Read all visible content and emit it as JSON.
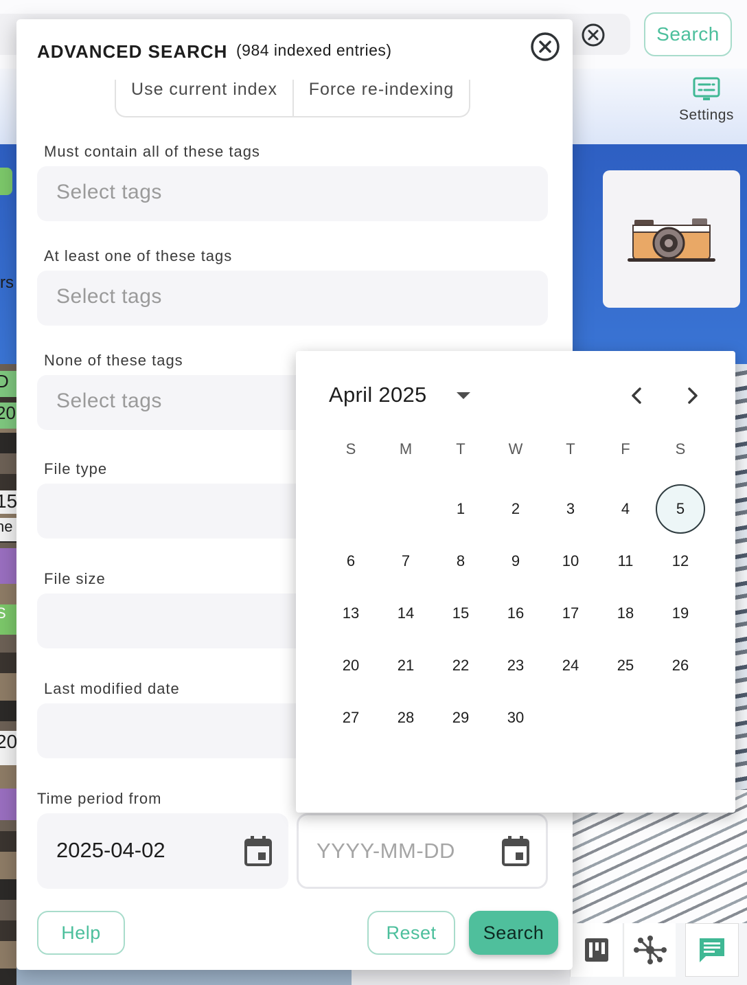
{
  "topbar": {
    "search_button_label": "Search"
  },
  "toolbar": {
    "settings_label": "Settings"
  },
  "background_tiles": {
    "side_fragments": [
      "D",
      "20",
      "15",
      "ne",
      "20",
      "rs",
      "S"
    ]
  },
  "modal": {
    "title": "ADVANCED SEARCH",
    "entry_count": "(984 indexed entries)",
    "index_options": [
      "Use current index",
      "Force re-indexing"
    ],
    "fields": {
      "must_contain": {
        "label": "Must contain all of these tags",
        "placeholder": "Select tags"
      },
      "at_least_one": {
        "label": "At least one of these tags",
        "placeholder": "Select tags"
      },
      "none_of": {
        "label": "None of these tags",
        "placeholder": "Select tags"
      },
      "file_type": {
        "label": "File type"
      },
      "file_size": {
        "label": "File size"
      },
      "last_modified": {
        "label": "Last modified date"
      },
      "time_period": {
        "label": "Time period from",
        "from_value": "2025-04-02",
        "to_placeholder": "YYYY-MM-DD"
      }
    },
    "buttons": {
      "help": "Help",
      "reset": "Reset",
      "search": "Search"
    }
  },
  "datepicker": {
    "month_label": "April 2025",
    "weekdays": [
      "S",
      "M",
      "T",
      "W",
      "T",
      "F",
      "S"
    ],
    "days": [
      "",
      "",
      "1",
      "2",
      "3",
      "4",
      "5",
      "6",
      "7",
      "8",
      "9",
      "10",
      "11",
      "12",
      "13",
      "14",
      "15",
      "16",
      "17",
      "18",
      "19",
      "20",
      "21",
      "22",
      "23",
      "24",
      "25",
      "26",
      "27",
      "28",
      "29",
      "30"
    ],
    "highlighted_day": "5"
  },
  "colors": {
    "accent": "#4fbf9c",
    "accent_border": "#a8dccb",
    "background_blue": "#3a74d4"
  },
  "icons": [
    "close-icon",
    "clear-search-icon",
    "settings-icon",
    "camera-icon",
    "calendar-icon",
    "chevron-left-icon",
    "chevron-right-icon",
    "caret-down-icon",
    "kanban-icon",
    "graph-icon",
    "chat-icon"
  ]
}
